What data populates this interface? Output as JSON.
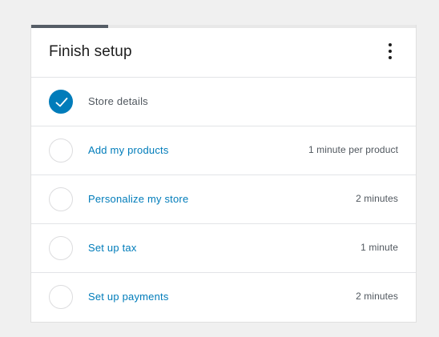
{
  "card": {
    "title": "Finish setup",
    "progress": 0.2
  },
  "tasks": [
    {
      "label": "Store details",
      "time": "",
      "completed": true
    },
    {
      "label": "Add my products",
      "time": "1 minute per product",
      "completed": false
    },
    {
      "label": "Personalize my store",
      "time": "2 minutes",
      "completed": false
    },
    {
      "label": "Set up tax",
      "time": "1 minute",
      "completed": false
    },
    {
      "label": "Set up payments",
      "time": "2 minutes",
      "completed": false
    }
  ],
  "colors": {
    "accent": "#007cba",
    "progress": "#555d66",
    "background": "#f0f0f0"
  },
  "icons": {
    "menu": "more-vertical-icon",
    "check": "checkmark-icon"
  }
}
